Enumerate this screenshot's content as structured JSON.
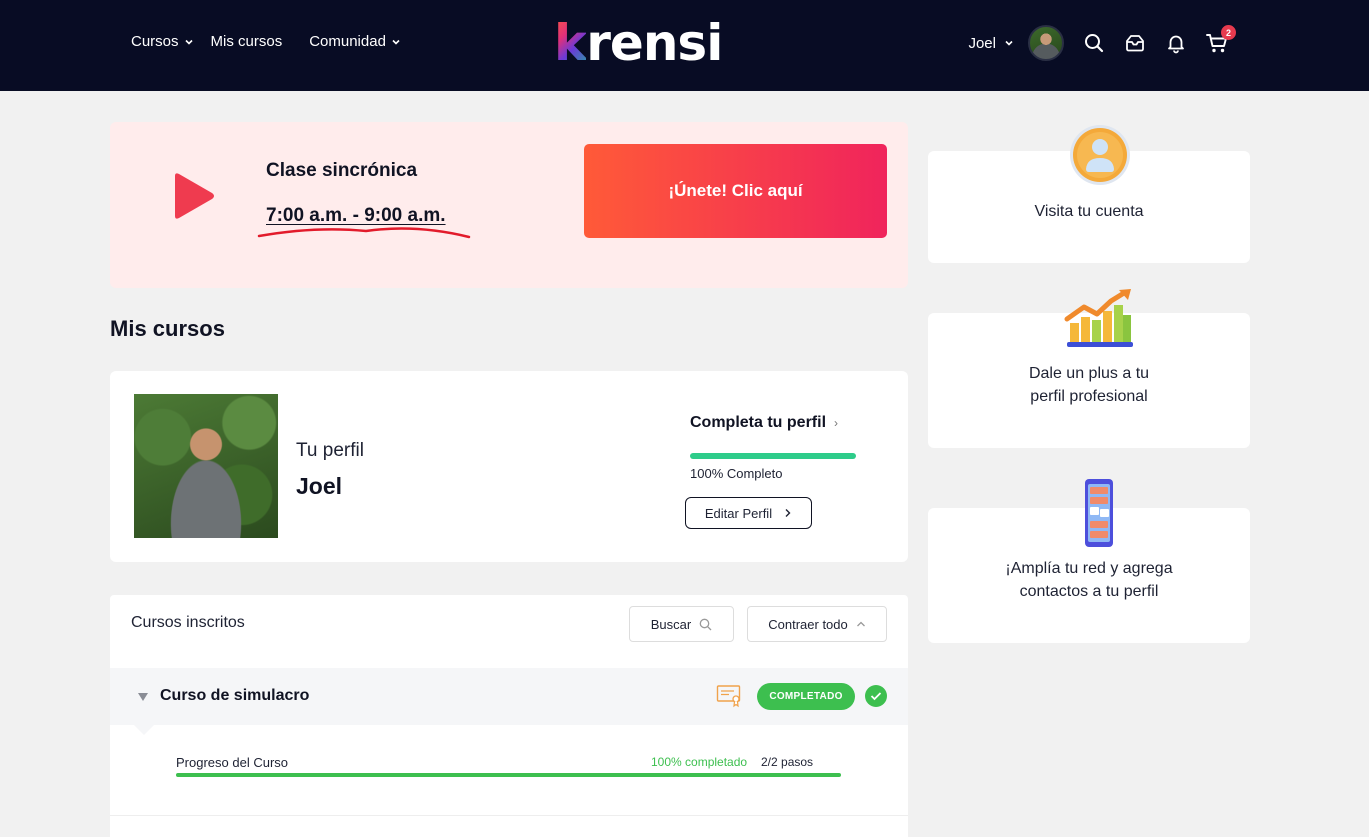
{
  "header": {
    "nav": [
      {
        "label": "Cursos",
        "has_dropdown": true
      },
      {
        "label": "Mis cursos",
        "has_dropdown": false
      },
      {
        "label": "Comunidad",
        "has_dropdown": true
      }
    ],
    "logo_text": "krensi",
    "user_name": "Joel",
    "icons": [
      "search-icon",
      "inbox-icon",
      "bell-icon",
      "cart-icon"
    ],
    "cart_count": "2"
  },
  "live_class": {
    "title": "Clase sincrónica",
    "time": "7:00 a.m. - 9:00 a.m.",
    "join_label": "¡Únete! Clic aquí",
    "accent_color": "#ef2f5a"
  },
  "section_title": "Mis cursos",
  "profile": {
    "label": "Tu perfil",
    "name": "Joel",
    "complete_link": "Completa tu perfil",
    "progress_percent": 100,
    "progress_text": "100% Completo",
    "edit_label": "Editar Perfil"
  },
  "courses": {
    "header_label": "Cursos inscritos",
    "search_label": "Buscar",
    "collapse_label": "Contraer todo",
    "items": [
      {
        "name": "Curso de simulacro",
        "status": "COMPLETADO",
        "progress_label": "Progreso del Curso",
        "progress_percent": 100,
        "progress_pct_text": "100% completado",
        "progress_steps": "2/2 pasos"
      }
    ]
  },
  "side_cards": [
    {
      "icon": "user-account-icon",
      "text": "Visita tu cuenta"
    },
    {
      "icon": "growth-chart-icon",
      "text_line1": "Dale un plus a tu",
      "text_line2": "perfil profesional"
    },
    {
      "icon": "network-phone-icon",
      "text_line1": "¡Amplía tu red y agrega",
      "text_line2": "contactos a tu perfil"
    }
  ],
  "colors": {
    "header_bg": "#080c24",
    "success": "#3dbf4f",
    "profile_progress": "#2ecc8a"
  }
}
